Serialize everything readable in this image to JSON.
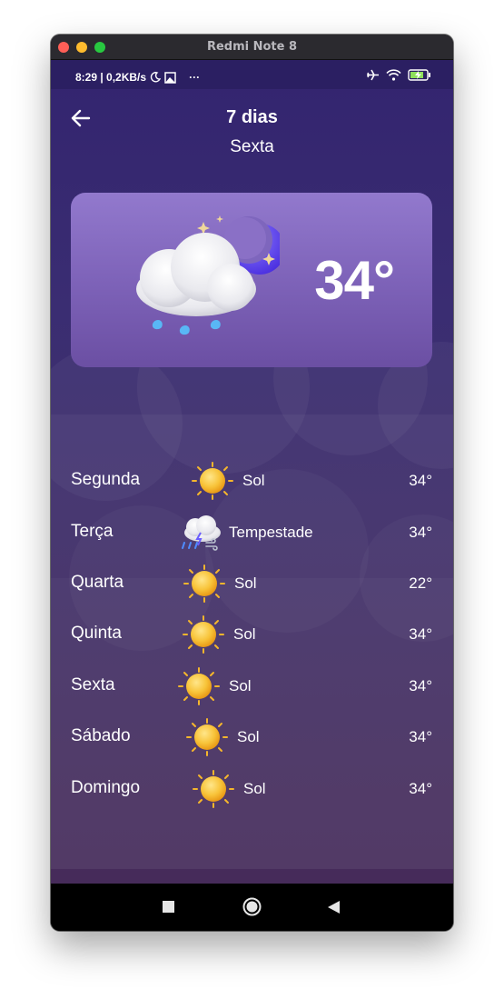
{
  "window": {
    "title": "Redmi Note 8"
  },
  "status_bar": {
    "text": "8:29 | 0,2KB/s",
    "more": "···"
  },
  "header": {
    "title": "7 dias",
    "subtitle": "Sexta"
  },
  "current": {
    "temperature": "34°",
    "icon": "night-cloud-rain-icon"
  },
  "forecast": [
    {
      "day": "Segunda",
      "condition": "Sol",
      "icon": "sun-icon",
      "temp": "34°"
    },
    {
      "day": "Terça",
      "condition": "Tempestade",
      "icon": "storm-cloud-icon",
      "temp": "34°"
    },
    {
      "day": "Quarta",
      "condition": "Sol",
      "icon": "sun-icon",
      "temp": "22°"
    },
    {
      "day": "Quinta",
      "condition": "Sol",
      "icon": "sun-icon",
      "temp": "34°"
    },
    {
      "day": "Sexta",
      "condition": "Sol",
      "icon": "sun-icon",
      "temp": "34°"
    },
    {
      "day": "Sábado",
      "condition": "Sol",
      "icon": "sun-icon",
      "temp": "34°"
    },
    {
      "day": "Domingo",
      "condition": "Sol",
      "icon": "sun-icon",
      "temp": "34°"
    }
  ],
  "colors": {
    "background_top": "#33246f",
    "background_bottom": "#462b5a",
    "card": "#8a70c6",
    "sun": "#f8b82a"
  }
}
